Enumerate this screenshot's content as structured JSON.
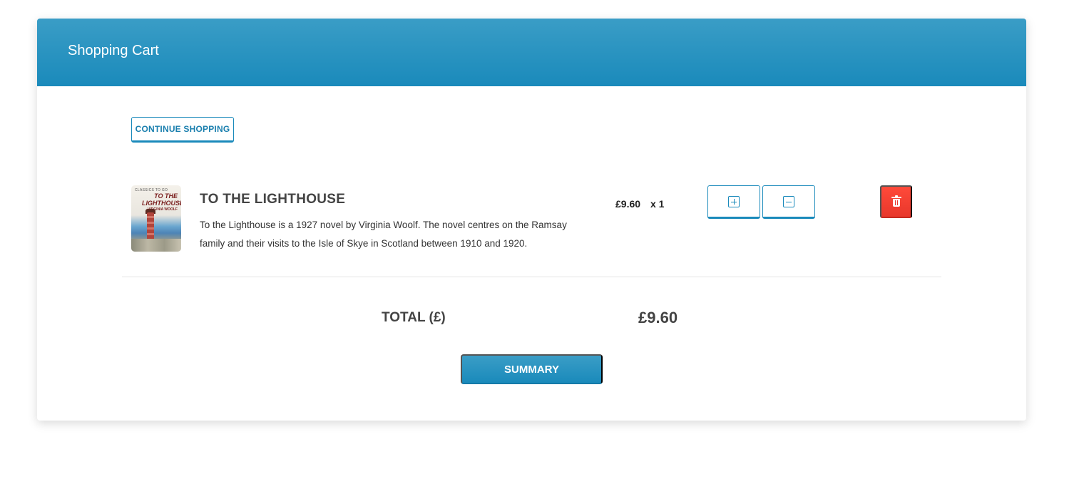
{
  "header": {
    "title": "Shopping Cart"
  },
  "actions": {
    "continue_label": "CONTINUE SHOPPING",
    "summary_label": "SUMMARY"
  },
  "cart": {
    "items": [
      {
        "title": "TO THE LIGHTHOUSE",
        "description": "To the Lighthouse is a 1927 novel by Virginia Woolf. The novel centres on the Ramsay family and their visits to the Isle of Skye in Scotland between 1910 and 1920.",
        "price": "£9.60",
        "quantity": "x 1",
        "cover": {
          "series": "CLASSICS TO GO",
          "title": "TO THE LIGHTHOUSE",
          "author": "VIRGINIA WOOLF"
        }
      }
    ],
    "total_label": "TOTAL (£)",
    "total_value": "£9.60"
  },
  "colors": {
    "primary": "#1a8abb",
    "danger": "#e8372b"
  },
  "icons": {
    "increase": "plus-icon",
    "decrease": "minus-icon",
    "delete": "trash-icon"
  }
}
